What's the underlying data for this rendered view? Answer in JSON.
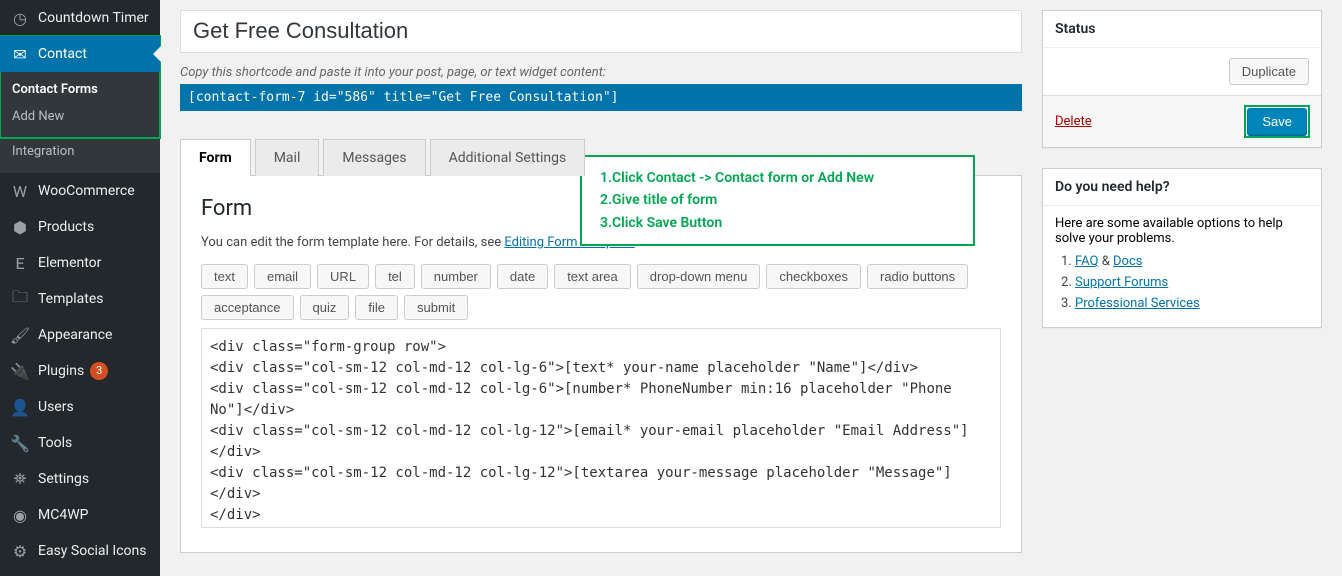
{
  "sidebar": {
    "items": [
      {
        "label": "Countdown Timer",
        "icon": "◷"
      },
      {
        "label": "Contact",
        "icon": "✉",
        "active": true
      },
      {
        "label": "WooCommerce",
        "icon": "W"
      },
      {
        "label": "Products",
        "icon": "⬢"
      },
      {
        "label": "Elementor",
        "icon": "E"
      },
      {
        "label": "Templates",
        "icon": "🗀"
      },
      {
        "label": "Appearance",
        "icon": "🖌"
      },
      {
        "label": "Plugins",
        "icon": "🔌",
        "badge": "3"
      },
      {
        "label": "Users",
        "icon": "👤"
      },
      {
        "label": "Tools",
        "icon": "🔧"
      },
      {
        "label": "Settings",
        "icon": "⛯"
      },
      {
        "label": "MC4WP",
        "icon": "◉"
      },
      {
        "label": "Easy Social Icons",
        "icon": "⚙"
      }
    ],
    "subitems": [
      "Contact Forms",
      "Add New",
      "Integration"
    ]
  },
  "form_title": "Get Free Consultation",
  "hint": "Copy this shortcode and paste it into your post, page, or text widget content:",
  "shortcode": "[contact-form-7 id=\"586\" title=\"Get Free Consultation\"]",
  "tabs": [
    "Form",
    "Mail",
    "Messages",
    "Additional Settings"
  ],
  "panel": {
    "heading": "Form",
    "desc_pre": "You can edit the form template here. For details, see ",
    "desc_link": "Editing Form Template",
    "tags": [
      "text",
      "email",
      "URL",
      "tel",
      "number",
      "date",
      "text area",
      "drop-down menu",
      "checkboxes",
      "radio buttons",
      "acceptance",
      "quiz",
      "file",
      "submit"
    ],
    "code": "<div class=\"form-group row\">\n<div class=\"col-sm-12 col-md-12 col-lg-6\">[text* your-name placeholder \"Name\"]</div>\n<div class=\"col-sm-12 col-md-12 col-lg-6\">[number* PhoneNumber min:16 placeholder \"Phone No\"]</div>\n<div class=\"col-sm-12 col-md-12 col-lg-12\">[email* your-email placeholder \"Email Address\"]</div>\n<div class=\"col-sm-12 col-md-12 col-lg-12\">[textarea your-message placeholder \"Message\"]</div>\n</div>\n<div class=\"form-group frm-btn row\">\n    <div class=\"col-sm-12 col-md-12 col-lg-12 btn-form\">\n      [submit \"SUBMIT NOW\"]\n    </div>"
  },
  "callout": {
    "l1": "1.Click Contact -> Contact form or Add New",
    "l2": "2.Give title of form",
    "l3": "3.Click Save Button"
  },
  "status": {
    "heading": "Status",
    "duplicate": "Duplicate",
    "delete": "Delete",
    "save": "Save"
  },
  "help": {
    "heading": "Do you need help?",
    "intro": "Here are some available options to help solve your problems.",
    "links": {
      "faq": "FAQ",
      "amp": " & ",
      "docs": "Docs",
      "forums": "Support Forums",
      "pro": "Professional Services"
    }
  }
}
